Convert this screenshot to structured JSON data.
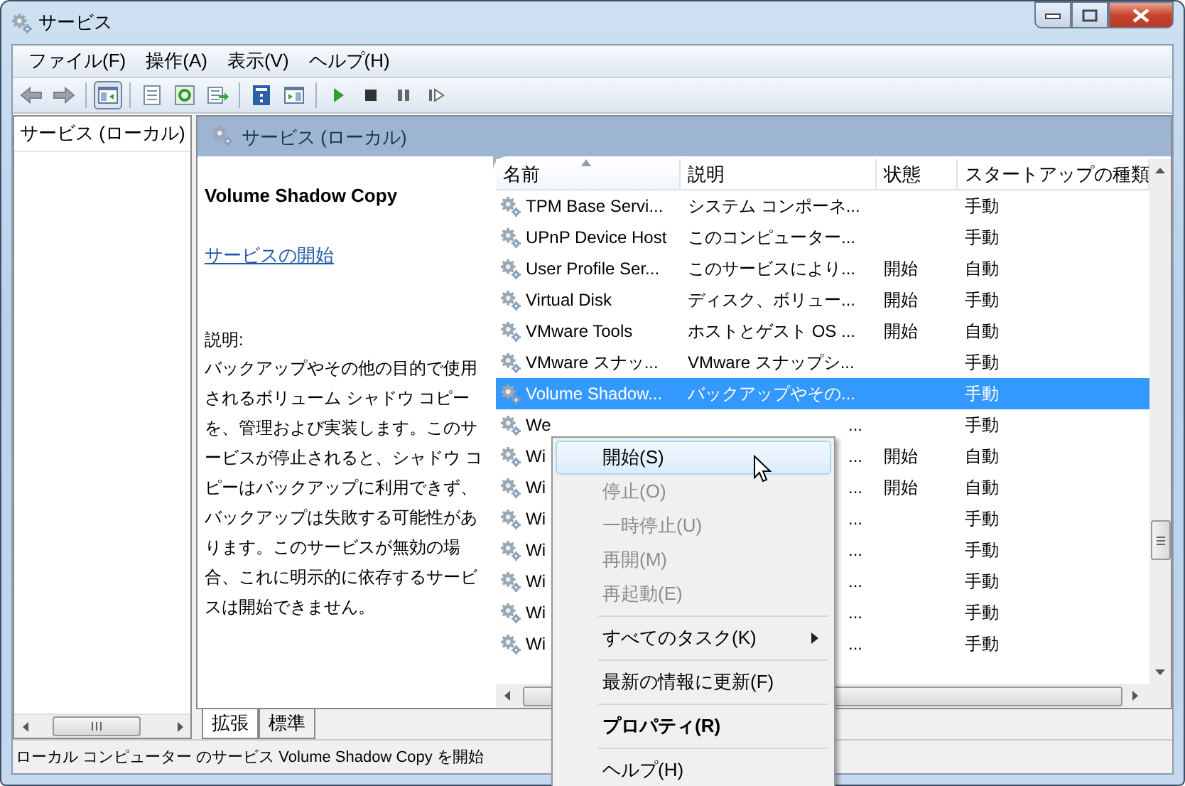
{
  "window": {
    "title": "サービス"
  },
  "menu_bar": [
    "ファイル(F)",
    "操作(A)",
    "表示(V)",
    "ヘルプ(H)"
  ],
  "toolbar": [
    {
      "kind": "back"
    },
    {
      "kind": "forward"
    },
    {
      "kind": "sep"
    },
    {
      "kind": "tree",
      "selected": true
    },
    {
      "kind": "sep"
    },
    {
      "kind": "properties"
    },
    {
      "kind": "refresh"
    },
    {
      "kind": "export"
    },
    {
      "kind": "sep"
    },
    {
      "kind": "help"
    },
    {
      "kind": "pane"
    },
    {
      "kind": "sep"
    },
    {
      "kind": "play"
    },
    {
      "kind": "stop"
    },
    {
      "kind": "pause"
    },
    {
      "kind": "resume"
    }
  ],
  "tree": {
    "items": [
      {
        "label": "サービス (ローカル)",
        "selected": false
      }
    ]
  },
  "pane_header": {
    "title": "サービス (ローカル)"
  },
  "details": {
    "title": "Volume Shadow Copy",
    "link": "サービスの開始",
    "description_label": "説明:",
    "description": "バックアップやその他の目的で使用されるボリューム シャドウ コピーを、管理および実装します。このサービスが停止されると、シャドウ コピーはバックアップに利用できず、バックアップは失敗する可能性があります。このサービスが無効の場合、これに明示的に依存するサービスは開始できません。"
  },
  "table": {
    "columns": [
      {
        "label": "名前",
        "sorted": true
      },
      {
        "label": "説明",
        "sorted": false
      },
      {
        "label": "状態",
        "sorted": false
      },
      {
        "label": "スタートアップの種類",
        "sorted": false
      }
    ],
    "rows": [
      {
        "name": "TPM Base Servi...",
        "description": "システム コンポーネ...",
        "status": "",
        "startup": "手動",
        "selected": false
      },
      {
        "name": "UPnP Device Host",
        "description": "このコンピューター...",
        "status": "",
        "startup": "手動",
        "selected": false
      },
      {
        "name": "User Profile Ser...",
        "description": "このサービスにより...",
        "status": "開始",
        "startup": "自動",
        "selected": false
      },
      {
        "name": "Virtual Disk",
        "description": "ディスク、ボリュー...",
        "status": "開始",
        "startup": "手動",
        "selected": false
      },
      {
        "name": "VMware Tools",
        "description": "ホストとゲスト OS ...",
        "status": "開始",
        "startup": "自動",
        "selected": false
      },
      {
        "name": "VMware スナッ...",
        "description": "VMware スナップシ...",
        "status": "",
        "startup": "手動",
        "selected": false
      },
      {
        "name": "Volume Shadow...",
        "description": "バックアップやその...",
        "status": "",
        "startup": "手動",
        "selected": true
      },
      {
        "name": "We",
        "description_tail": "...",
        "status": "",
        "startup": "手動",
        "selected": false
      },
      {
        "name": "Wi",
        "description_tail": "...",
        "status": "開始",
        "startup": "自動",
        "selected": false
      },
      {
        "name": "Wi",
        "description_tail": "...",
        "status": "開始",
        "startup": "自動",
        "selected": false
      },
      {
        "name": "Wi",
        "description_tail": "...",
        "status": "",
        "startup": "手動",
        "selected": false
      },
      {
        "name": "Wi",
        "description_tail": "...",
        "status": "",
        "startup": "手動",
        "selected": false
      },
      {
        "name": "Wi",
        "description_tail": "...",
        "status": "",
        "startup": "手動",
        "selected": false
      },
      {
        "name": "Wi",
        "description_tail": "...",
        "status": "",
        "startup": "手動",
        "selected": false
      },
      {
        "name": "Wi",
        "description_tail": "...",
        "status": "",
        "startup": "手動",
        "selected": false
      }
    ]
  },
  "view_tabs": [
    {
      "label": "拡張",
      "selected": true
    },
    {
      "label": "標準",
      "selected": false
    }
  ],
  "status_bar": {
    "text": "ローカル コンピューター のサービス Volume Shadow Copy を開始"
  },
  "context_menu": {
    "items": [
      {
        "kind": "item",
        "label": "開始(S)",
        "selected": true,
        "disabled": false
      },
      {
        "kind": "item",
        "label": "停止(O)",
        "selected": false,
        "disabled": true
      },
      {
        "kind": "item",
        "label": "一時停止(U)",
        "selected": false,
        "disabled": true
      },
      {
        "kind": "item",
        "label": "再開(M)",
        "selected": false,
        "disabled": true
      },
      {
        "kind": "item",
        "label": "再起動(E)",
        "selected": false,
        "disabled": true
      },
      {
        "kind": "separator"
      },
      {
        "kind": "submenu",
        "label": "すべてのタスク(K)",
        "selected": false,
        "disabled": false
      },
      {
        "kind": "separator"
      },
      {
        "kind": "item",
        "label": "最新の情報に更新(F)",
        "selected": false,
        "disabled": false
      },
      {
        "kind": "separator"
      },
      {
        "kind": "default",
        "label": "プロパティ(R)",
        "selected": false,
        "disabled": false
      },
      {
        "kind": "separator"
      },
      {
        "kind": "item",
        "label": "ヘルプ(H)",
        "selected": false,
        "disabled": false
      }
    ]
  }
}
